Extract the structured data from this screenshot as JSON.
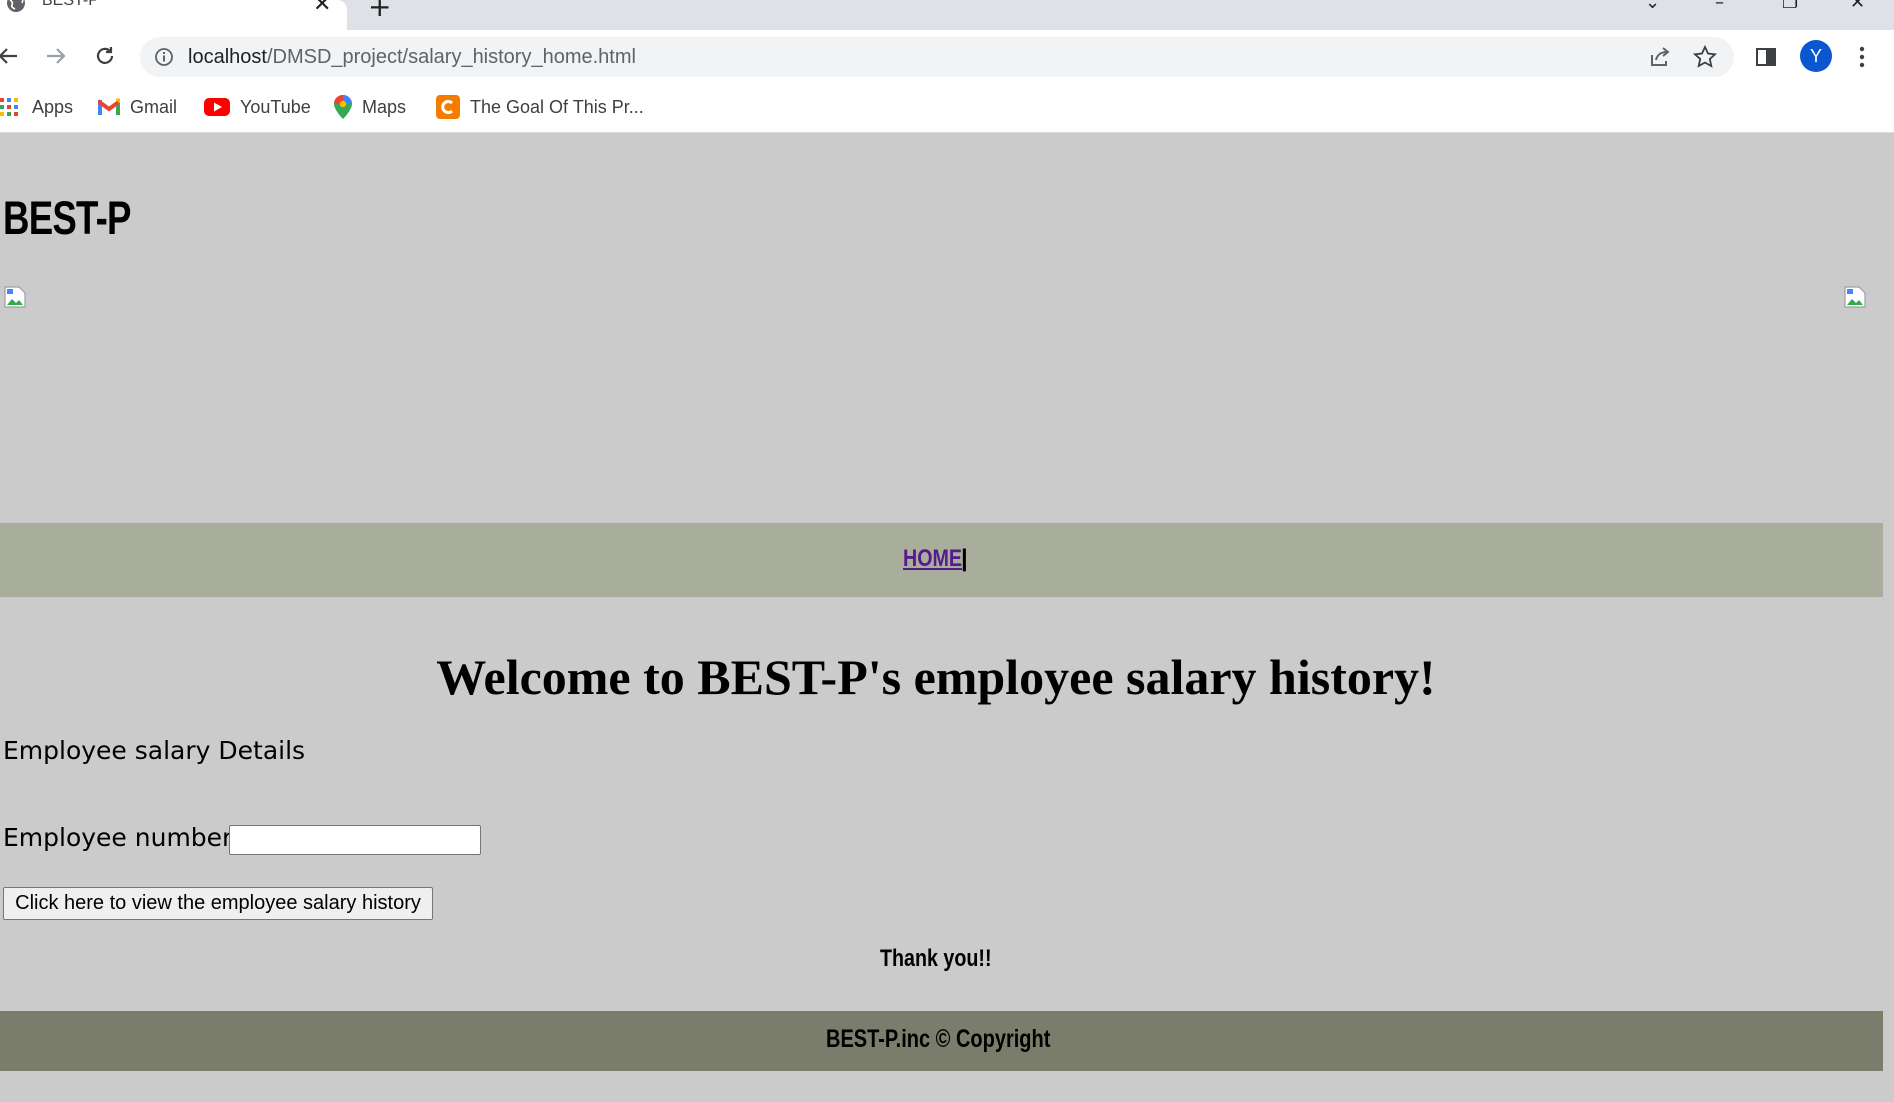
{
  "browser": {
    "tab_title": "BEST-P",
    "url_host": "localhost",
    "url_path": "/DMSD_project/salary_history_home.html",
    "profile_initial": "Y",
    "bookmarks": [
      {
        "label": "Apps",
        "icon": "apps-grid-icon"
      },
      {
        "label": "Gmail",
        "icon": "gmail-icon"
      },
      {
        "label": "YouTube",
        "icon": "youtube-icon"
      },
      {
        "label": "Maps",
        "icon": "maps-pin-icon"
      },
      {
        "label": "The Goal Of This Pr...",
        "icon": "c-logo-icon"
      }
    ],
    "colors": {
      "tabstrip": "#dee1e6",
      "omnibox": "#f1f3f4",
      "avatar": "#0b57d0"
    }
  },
  "page": {
    "brand": "BEST-P",
    "nav": {
      "home_label": "HOME",
      "separator": "|"
    },
    "welcome": "Welcome to BEST-P's employee salary history!",
    "section_title": "Employee salary Details",
    "form": {
      "employee_number_label": "Employee number",
      "employee_number_value": "",
      "submit_label": "Click here to view the employee salary history"
    },
    "thanks": "Thank you!!",
    "footer": "BEST-P.inc © Copyright",
    "colors": {
      "background": "#cbcbcb",
      "navbar": "#a9ad9c",
      "footer": "#7a7d6b",
      "link": "#551a8b"
    }
  }
}
